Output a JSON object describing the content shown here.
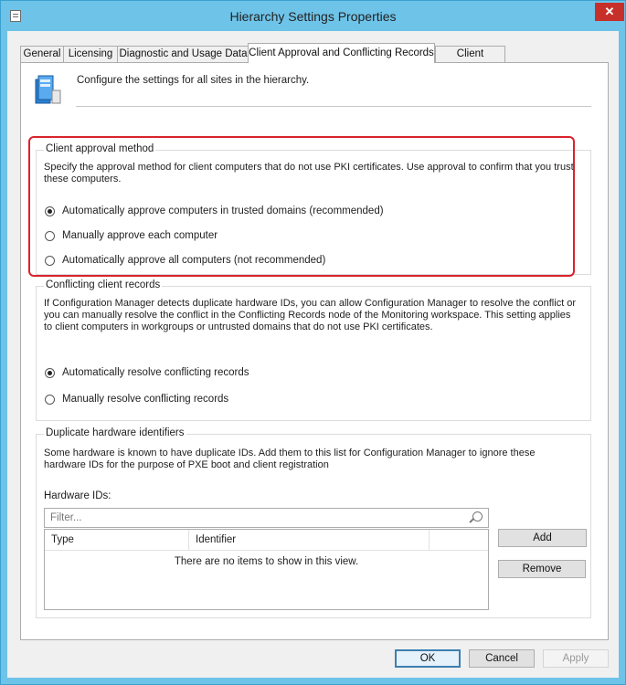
{
  "window": {
    "title": "Hierarchy Settings Properties",
    "close_glyph": "✕"
  },
  "tabs": [
    {
      "label": "General"
    },
    {
      "label": "Licensing"
    },
    {
      "label": "Diagnostic and Usage Data"
    },
    {
      "label": "Client Approval and Conflicting Records",
      "active": true
    },
    {
      "label": "Client Upgrade"
    }
  ],
  "intro": {
    "icon": "hierarchy-settings-icon",
    "text": "Configure the settings for all sites in the hierarchy."
  },
  "approval": {
    "title": "Client approval method",
    "description": "Specify the approval method for client computers that do not use PKI certificates. Use approval to confirm that you trust these computers.",
    "options": [
      {
        "label": "Automatically approve computers in trusted domains (recommended)",
        "checked": true
      },
      {
        "label": "Manually approve each computer",
        "checked": false
      },
      {
        "label": "Automatically approve all computers (not recommended)",
        "checked": false
      }
    ]
  },
  "conflicting": {
    "title": "Conflicting client records",
    "description": "If Configuration Manager detects duplicate hardware IDs, you can allow Configuration Manager to resolve the conflict or you can manually resolve the conflict in the Conflicting Records node of the Monitoring workspace. This setting applies to client computers in workgroups or untrusted domains that do not use PKI certificates.",
    "options": [
      {
        "label": "Automatically resolve conflicting records",
        "checked": true
      },
      {
        "label": "Manually resolve conflicting records",
        "checked": false
      }
    ]
  },
  "duplicates": {
    "title": "Duplicate hardware identifiers",
    "description": "Some hardware is known to have duplicate IDs. Add them to this list for Configuration Manager to ignore these hardware IDs for the purpose of PXE boot and client registration",
    "hardware_ids_label": "Hardware IDs:",
    "filter_placeholder": "Filter...",
    "columns": [
      "Type",
      "Identifier"
    ],
    "empty_text": "There are no items to show in this view.",
    "add_label": "Add",
    "remove_label": "Remove"
  },
  "footer": {
    "ok_label": "OK",
    "cancel_label": "Cancel",
    "apply_label": "Apply"
  },
  "colors": {
    "highlight": "#d9232d",
    "titlebar": "#6ec3e8",
    "close": "#c7302a"
  }
}
